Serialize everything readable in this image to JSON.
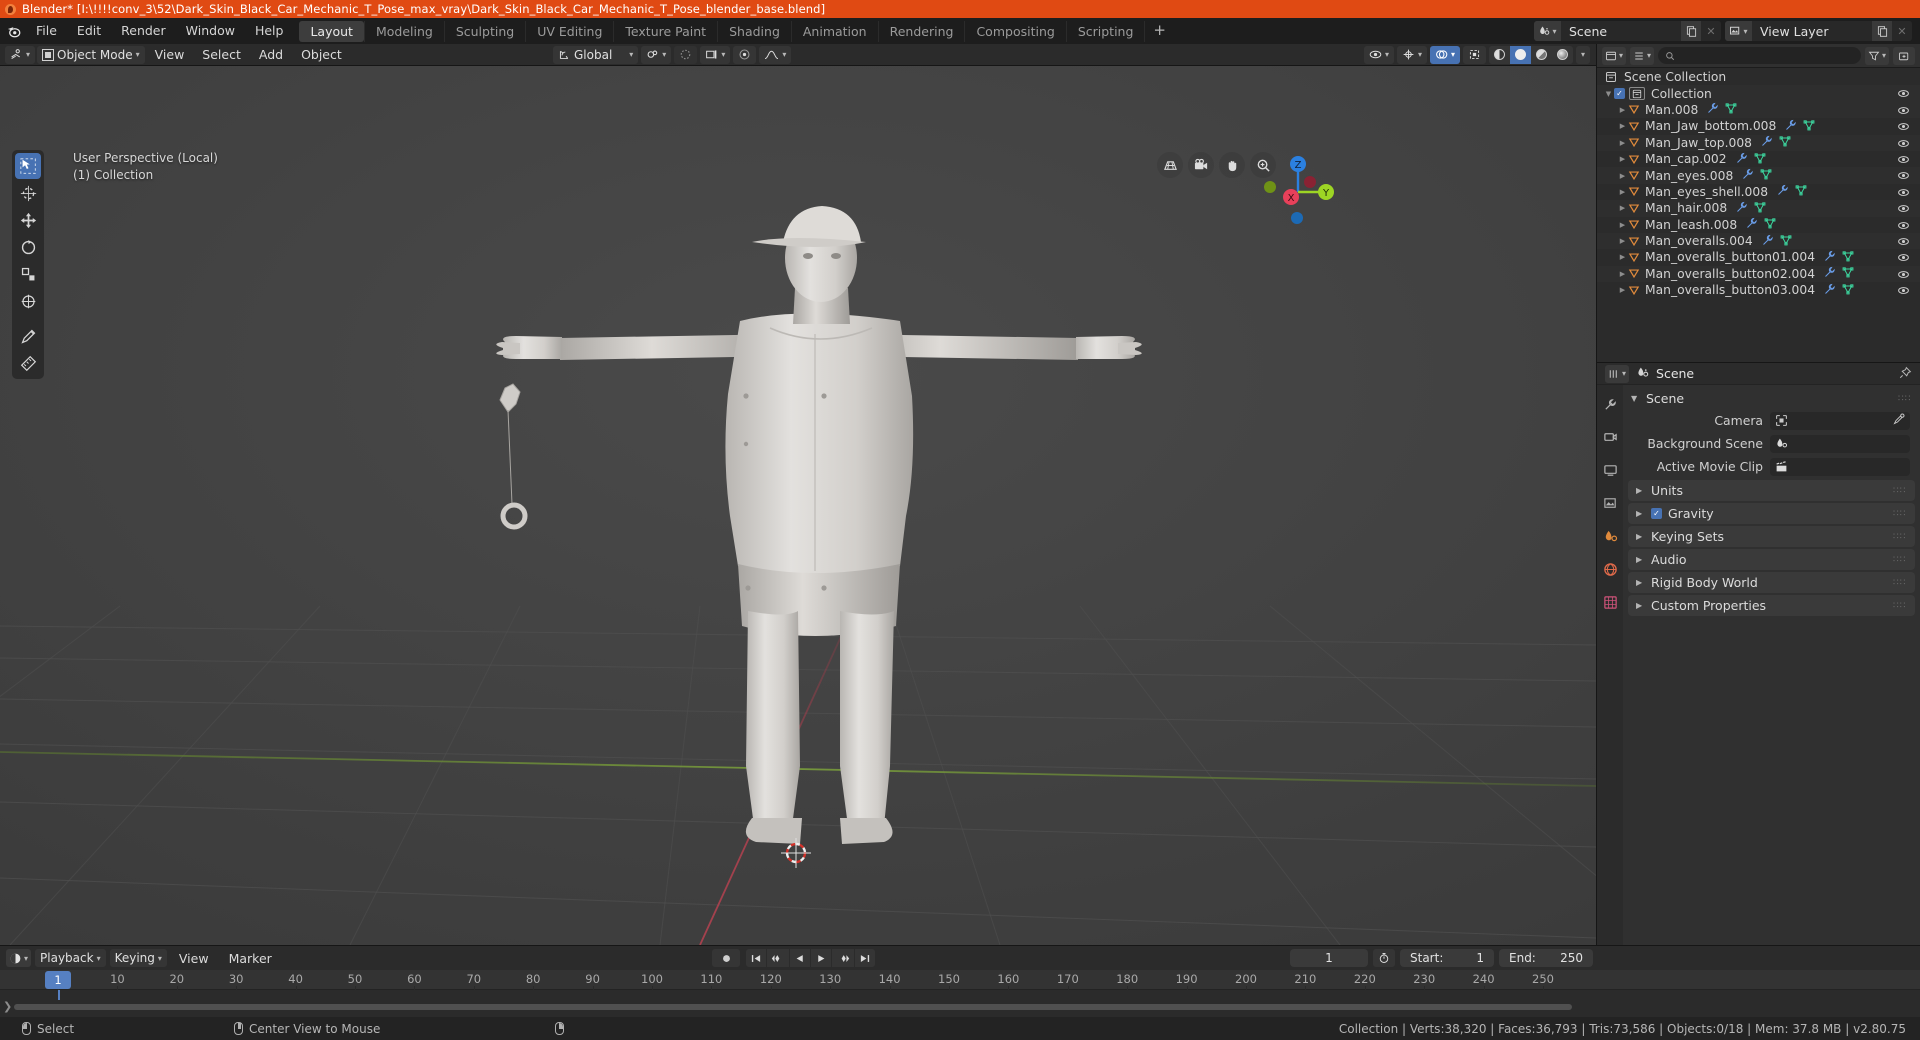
{
  "window": {
    "title": "Blender* [I:\\!!!!conv_3\\52\\Dark_Skin_Black_Car_Mechanic_T_Pose_max_vray\\Dark_Skin_Black_Car_Mechanic_T_Pose_blender_base.blend]"
  },
  "topbar": {
    "menus": [
      "File",
      "Edit",
      "Render",
      "Window",
      "Help"
    ],
    "workspaces": [
      "Layout",
      "Modeling",
      "Sculpting",
      "UV Editing",
      "Texture Paint",
      "Shading",
      "Animation",
      "Rendering",
      "Compositing",
      "Scripting"
    ],
    "active_workspace": "Layout",
    "add_workspace_label": "+",
    "scene_name": "Scene",
    "view_layer_name": "View Layer"
  },
  "viewport_header": {
    "mode": "Object Mode",
    "menus": [
      "View",
      "Select",
      "Add",
      "Object"
    ],
    "transform_orientation": "Global"
  },
  "viewport": {
    "perspective_label": "User Perspective (Local)",
    "collection_label": "(1) Collection",
    "gizmo_axes": [
      "X",
      "Y",
      "Z"
    ],
    "nav_icons": [
      "grid-icon",
      "camera-icon",
      "hand-icon",
      "zoom-icon"
    ],
    "tools": [
      "select-box-tool",
      "cursor-tool",
      "move-tool",
      "rotate-tool",
      "scale-tool",
      "transform-tool",
      "annotate-tool",
      "measure-tool"
    ]
  },
  "outliner": {
    "search_placeholder": "",
    "root": "Scene Collection",
    "collection": "Collection",
    "items": [
      {
        "name": "Man.008"
      },
      {
        "name": "Man_Jaw_bottom.008"
      },
      {
        "name": "Man_Jaw_top.008"
      },
      {
        "name": "Man_cap.002"
      },
      {
        "name": "Man_eyes.008"
      },
      {
        "name": "Man_eyes_shell.008"
      },
      {
        "name": "Man_hair.008"
      },
      {
        "name": "Man_leash.008"
      },
      {
        "name": "Man_overalls.004"
      },
      {
        "name": "Man_overalls_button01.004"
      },
      {
        "name": "Man_overalls_button02.004"
      },
      {
        "name": "Man_overalls_button03.004"
      }
    ]
  },
  "properties": {
    "breadcrumb": "Scene",
    "panels": [
      {
        "label": "Scene",
        "expanded": true
      },
      {
        "label": "Units",
        "expanded": false
      },
      {
        "label": "Gravity",
        "expanded": false,
        "checked": true
      },
      {
        "label": "Keying Sets",
        "expanded": false
      },
      {
        "label": "Audio",
        "expanded": false
      },
      {
        "label": "Rigid Body World",
        "expanded": false
      },
      {
        "label": "Custom Properties",
        "expanded": false
      }
    ],
    "fields": [
      {
        "label": "Camera",
        "value": "",
        "icon": "camera-field-icon",
        "eyedropper": true
      },
      {
        "label": "Background Scene",
        "value": "",
        "icon": "scene-field-icon",
        "eyedropper": false
      },
      {
        "label": "Active Movie Clip",
        "value": "",
        "icon": "clip-field-icon",
        "eyedropper": false
      }
    ]
  },
  "timeline": {
    "menus": [
      "Playback",
      "Keying",
      "View",
      "Marker"
    ],
    "current_frame": "1",
    "start_label": "Start:",
    "start_value": "1",
    "end_label": "End:",
    "end_value": "250",
    "ticks": [
      "1",
      "10",
      "20",
      "30",
      "40",
      "50",
      "60",
      "70",
      "80",
      "90",
      "100",
      "110",
      "120",
      "130",
      "140",
      "150",
      "160",
      "170",
      "180",
      "190",
      "200",
      "210",
      "220",
      "230",
      "240",
      "250"
    ],
    "playhead_frame": "1"
  },
  "statusbar": {
    "left_items": [
      {
        "icon": "mouse-left-icon",
        "label": "Select"
      },
      {
        "icon": "mouse-middle-icon",
        "label": "Center View to Mouse"
      },
      {
        "icon": "mouse-right-icon",
        "label": ""
      }
    ],
    "stats": "Collection | Verts:38,320 | Faces:36,793 | Tris:73,586 | Objects:0/18 | Mem: 37.8 MB | v2.80.75"
  },
  "colors": {
    "accent_orange": "#e04a13",
    "accent_blue": "#4772b3",
    "axis_x": "#e8405a",
    "axis_y": "#9dd524",
    "axis_z": "#2b80e0",
    "mesh_orange": "#e08a3c",
    "modifier_blue": "#6a9de8",
    "mesh_data_green": "#3cd8a0"
  }
}
